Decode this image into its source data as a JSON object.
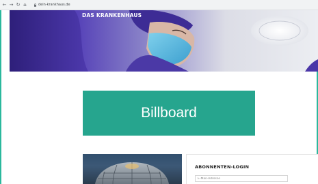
{
  "browser": {
    "back_glyph": "←",
    "forward_glyph": "→",
    "reload_glyph": "↻",
    "home_glyph": "⌂",
    "url": "dein-krankhaus.de",
    "icons": [
      "back-arrow-icon",
      "forward-arrow-icon",
      "reload-icon",
      "home-icon",
      "lock-icon"
    ]
  },
  "hero": {
    "site_title": "DAS KRANKENHAUS"
  },
  "billboard": {
    "label": "Billboard"
  },
  "login": {
    "title": "ABONNENTEN-LOGIN",
    "email_placeholder": "E-Mail-Adresse"
  },
  "colors": {
    "accent": "#26a58e",
    "frame": "#2bb89d",
    "hero_purple": "#4a36a8",
    "mask_blue": "#4fb3d9"
  }
}
